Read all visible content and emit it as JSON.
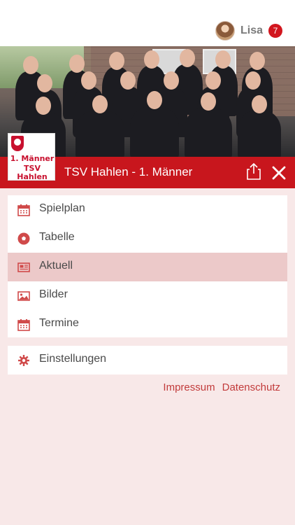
{
  "user": {
    "name": "Lisa",
    "notification_count": "7"
  },
  "team_title": "TSV Hahlen - 1. Männer",
  "logo": {
    "line1": "1. Männer",
    "line2": "TSV Hahlen"
  },
  "accent_color": "#c8161d",
  "menu": {
    "items": [
      {
        "label": "Spielplan",
        "icon": "calendar-icon"
      },
      {
        "label": "Tabelle",
        "icon": "soccer-ball-icon"
      },
      {
        "label": "Aktuell",
        "icon": "newspaper-icon",
        "active": true
      },
      {
        "label": "Bilder",
        "icon": "image-icon"
      },
      {
        "label": "Termine",
        "icon": "calendar-icon"
      }
    ]
  },
  "settings": {
    "label": "Einstellungen",
    "icon": "gear-icon"
  },
  "footer": {
    "impressum": "Impressum",
    "datenschutz": "Datenschutz"
  }
}
